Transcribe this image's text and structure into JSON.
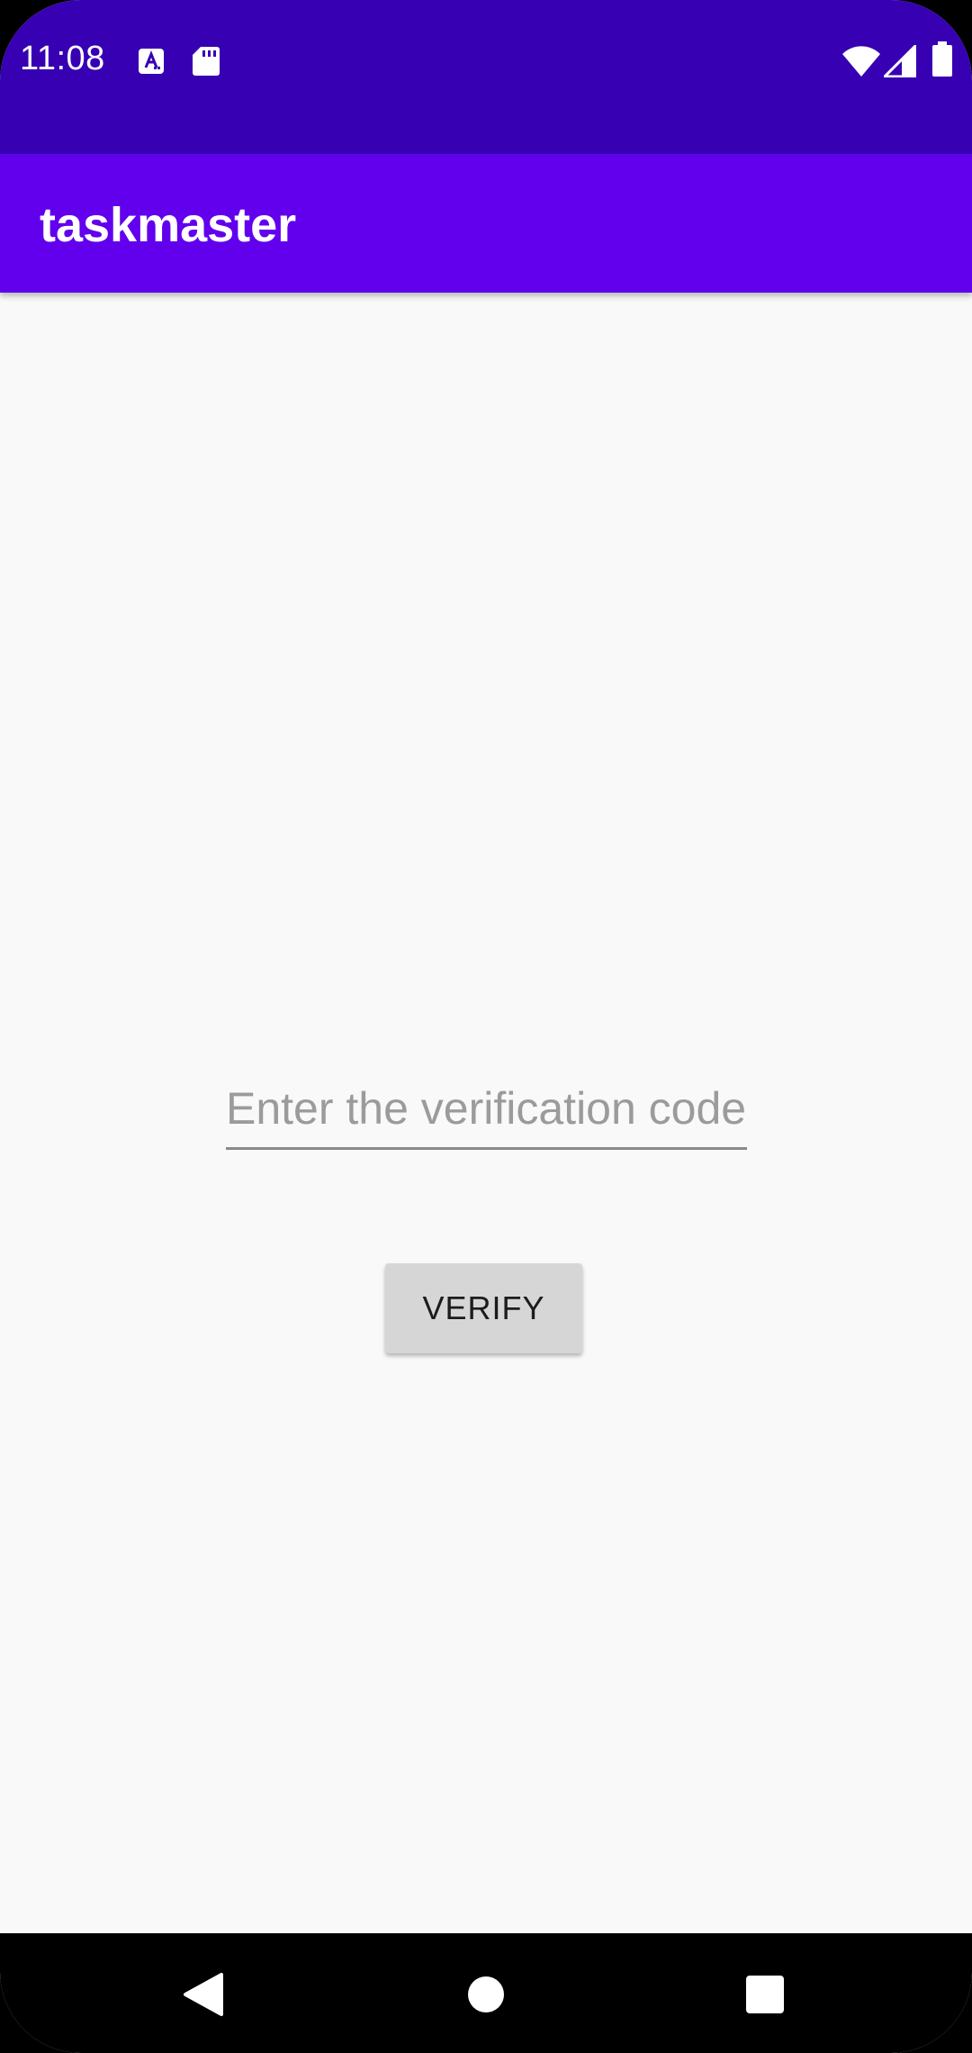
{
  "status_bar": {
    "time": "11:08",
    "background": "#3700b3",
    "left_icons": [
      "keyboard-a-icon",
      "sd-card-icon"
    ],
    "right_icons": [
      "wifi-icon",
      "signal-icon",
      "battery-icon"
    ]
  },
  "app_bar": {
    "title": "taskmaster",
    "background": "#6200ee"
  },
  "verification": {
    "code_placeholder": "Enter the verification code",
    "code_value": "",
    "verify_label": "VERIFY"
  },
  "nav_bar": {
    "buttons": [
      "back-icon",
      "home-icon",
      "recents-icon"
    ]
  }
}
